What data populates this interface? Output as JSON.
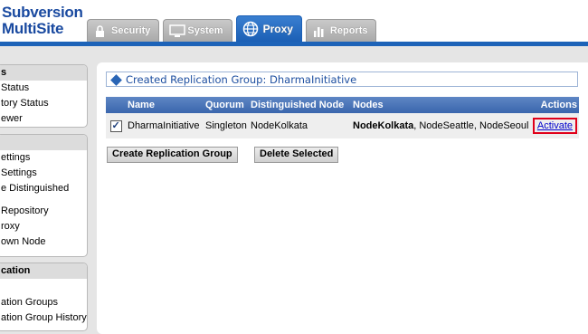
{
  "app": {
    "logo_line1": "Subversion",
    "logo_line2": "MultiSite"
  },
  "tabs": [
    {
      "label": "Security",
      "icon": "lock-icon",
      "active": false
    },
    {
      "label": "System",
      "icon": "monitor-icon",
      "active": false
    },
    {
      "label": "Proxy",
      "icon": "globe-icon",
      "active": true
    },
    {
      "label": "Reports",
      "icon": "bar-chart-icon",
      "active": false
    }
  ],
  "sidebar": {
    "group1": {
      "heading": "s",
      "items": [
        "Status",
        "tory Status",
        "ewer"
      ]
    },
    "group2": {
      "heading": "",
      "items": [
        "ettings",
        "Settings",
        "e Distinguished",
        "Repository",
        "roxy",
        "own Node"
      ]
    },
    "group3": {
      "heading": "cation",
      "items": [
        "ation Groups",
        "ation Group History"
      ]
    }
  },
  "message": "Created Replication Group: DharmaInitiative",
  "table": {
    "columns": [
      "Name",
      "Quorum",
      "Distinguished Node",
      "Nodes",
      "Actions"
    ],
    "rows": [
      {
        "name": "DharmaInitiative",
        "quorum": "Singleton",
        "distinguished_node": "NodeKolkata",
        "nodes_bold": "NodeKolkata",
        "nodes_rest": ", NodeSeattle, NodeSeoul",
        "action": "Activate",
        "checked": true
      }
    ]
  },
  "buttons": {
    "create": "Create Replication Group",
    "delete": "Delete Selected"
  },
  "colors": {
    "brand_blue": "#1d63b8",
    "highlight_red": "#e0001a"
  }
}
